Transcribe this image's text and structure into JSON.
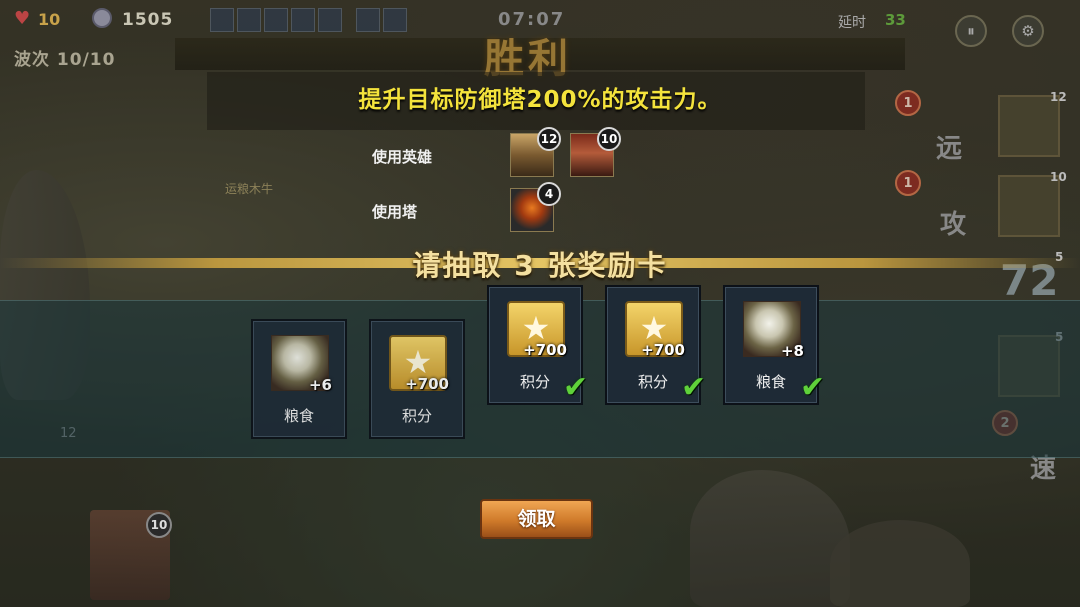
{
  "hud": {
    "hp": "10",
    "coins": "1505",
    "timer": "07:07",
    "delay_label": "延时",
    "delay_value": "33",
    "wave_label": "波次",
    "wave_value": "10/10"
  },
  "victory": {
    "title": "胜利",
    "goal": "提升目标防御塔200%的攻击力。"
  },
  "usage": {
    "heroes_label": "使用英雄",
    "heroes": [
      {
        "level": "12",
        "icon": "hero-zhuge-portrait"
      },
      {
        "level": "10",
        "icon": "hero-red-portrait"
      }
    ],
    "towers_label": "使用塔",
    "towers": [
      {
        "level": "4",
        "icon": "fire-tower-portrait"
      }
    ]
  },
  "draw_prompt": "请抽取 3 张奖励卡",
  "cards": [
    {
      "type": "grain",
      "amount": "+6",
      "name": "粮食",
      "selected": false
    },
    {
      "type": "points",
      "amount": "+700",
      "name": "积分",
      "selected": false
    },
    {
      "type": "points",
      "amount": "+700",
      "name": "积分",
      "selected": true
    },
    {
      "type": "points",
      "amount": "+700",
      "name": "积分",
      "selected": true
    },
    {
      "type": "grain",
      "amount": "+8",
      "name": "粮食",
      "selected": true
    }
  ],
  "claim_label": "领取",
  "background": {
    "ground_text": "运粮木牛",
    "side_labels": [
      "远",
      "攻",
      "速"
    ],
    "side_numbers": [
      "12",
      "10",
      "5",
      "5"
    ],
    "badge_values": [
      "1",
      "1",
      "2"
    ],
    "big_number": "72",
    "hero_level": "10",
    "misc_number": "12"
  },
  "colors": {
    "goal_text": "#f4e33c",
    "check": "#5fd13a",
    "claim_button": "#cf7a2a"
  }
}
